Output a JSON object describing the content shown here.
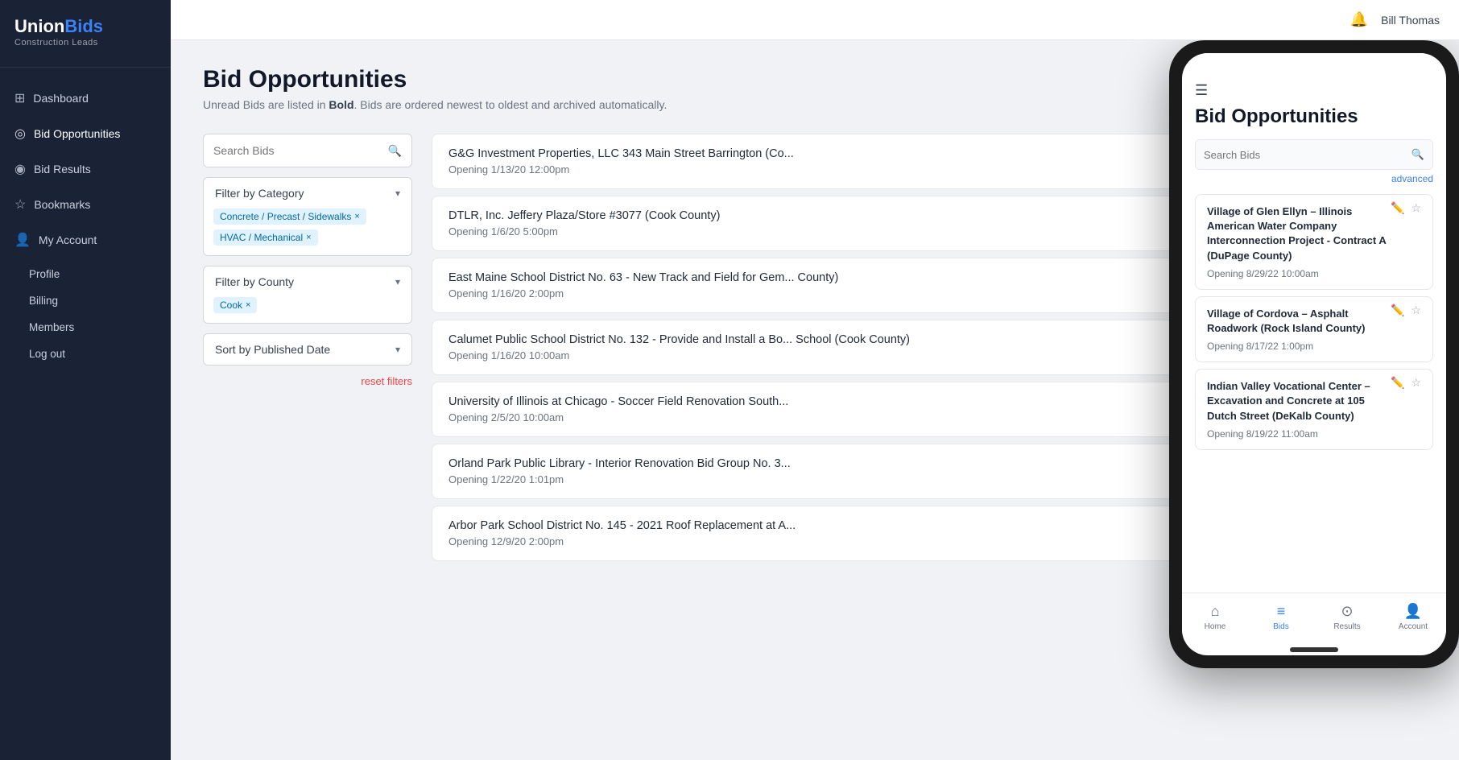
{
  "sidebar": {
    "logo": {
      "union": "Union",
      "bids": "Bids",
      "sub": "Construction Leads"
    },
    "nav_items": [
      {
        "id": "dashboard",
        "label": "Dashboard",
        "icon": "⊞"
      },
      {
        "id": "bid-opportunities",
        "label": "Bid Opportunities",
        "icon": "◎"
      },
      {
        "id": "bid-results",
        "label": "Bid Results",
        "icon": "◉"
      },
      {
        "id": "bookmarks",
        "label": "Bookmarks",
        "icon": "☆"
      },
      {
        "id": "my-account",
        "label": "My Account",
        "icon": "👤"
      }
    ],
    "sub_items": [
      {
        "id": "profile",
        "label": "Profile"
      },
      {
        "id": "billing",
        "label": "Billing"
      },
      {
        "id": "members",
        "label": "Members"
      },
      {
        "id": "logout",
        "label": "Log out"
      }
    ]
  },
  "topbar": {
    "user": "Bill Thomas"
  },
  "page": {
    "title": "Bid Opportunities",
    "subtitle_prefix": "Unread Bids are listed in ",
    "subtitle_bold": "Bold",
    "subtitle_suffix": ". Bids are ordered newest to oldest and archived automatically."
  },
  "filters": {
    "search_placeholder": "Search Bids",
    "category_label": "Filter by Category",
    "county_label": "Filter by County",
    "sort_label": "Sort by Published Date",
    "reset_label": "reset filters",
    "category_tags": [
      {
        "id": "concrete",
        "label": "Concrete / Precast / Sidewalks"
      },
      {
        "id": "hvac",
        "label": "HVAC / Mechanical"
      }
    ],
    "county_tags": [
      {
        "id": "cook",
        "label": "Cook"
      }
    ]
  },
  "bids": [
    {
      "id": 1,
      "title": "G&G Investment Properties, LLC 343 Main Street Barrington (Co...",
      "date": "Opening 1/13/20 12:00pm"
    },
    {
      "id": 2,
      "title": "DTLR, Inc. Jeffery Plaza/Store #3077 (Cook County)",
      "date": "Opening 1/6/20 5:00pm"
    },
    {
      "id": 3,
      "title": "East Maine School District No. 63 - New Track and Field for Gem... County)",
      "date": "Opening 1/16/20 2:00pm"
    },
    {
      "id": 4,
      "title": "Calumet Public School District No. 132 - Provide and Install a Bo... School (Cook County)",
      "date": "Opening 1/16/20 10:00am"
    },
    {
      "id": 5,
      "title": "University of Illinois at Chicago - Soccer Field Renovation South...",
      "date": "Opening 2/5/20 10:00am"
    },
    {
      "id": 6,
      "title": "Orland Park Public Library - Interior Renovation Bid Group No. 3...",
      "date": "Opening 1/22/20 1:01pm"
    },
    {
      "id": 7,
      "title": "Arbor Park School District No. 145 - 2021 Roof Replacement at A...",
      "date": "Opening 12/9/20 2:00pm"
    }
  ],
  "phone": {
    "title": "Bid Opportunities",
    "search_placeholder": "Search Bids",
    "advanced_label": "advanced",
    "bids": [
      {
        "id": 1,
        "title": "Village of Glen Ellyn – Illinois American Water Company Interconnection Project - Contract A (DuPage County)",
        "date": "Opening 8/29/22 10:00am"
      },
      {
        "id": 2,
        "title": "Village of Cordova – Asphalt Roadwork (Rock Island County)",
        "date": "Opening 8/17/22 1:00pm"
      },
      {
        "id": 3,
        "title": "Indian Valley Vocational Center – Excavation and Concrete at 105 Dutch Street (DeKalb County)",
        "date": "Opening 8/19/22 11:00am"
      }
    ],
    "nav_items": [
      {
        "id": "home",
        "label": "Home",
        "icon": "⌂",
        "active": false
      },
      {
        "id": "bids",
        "label": "Bids",
        "icon": "≡",
        "active": true
      },
      {
        "id": "results",
        "label": "Results",
        "icon": "⊙",
        "active": false
      },
      {
        "id": "account",
        "label": "Account",
        "icon": "👤",
        "active": false
      }
    ]
  }
}
